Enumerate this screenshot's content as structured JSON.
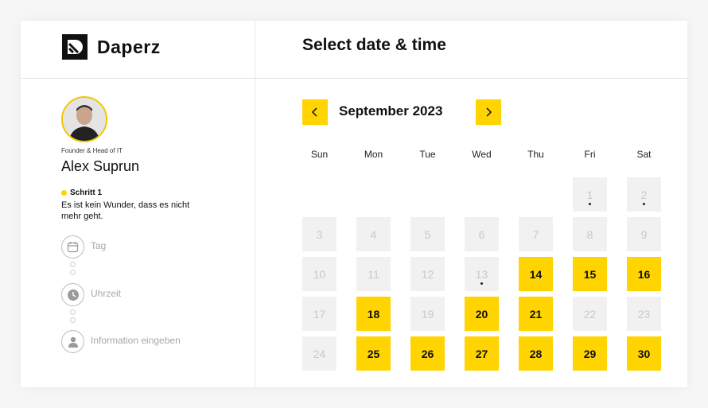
{
  "app": {
    "name": "Daperz"
  },
  "header": {
    "title": "Select date & time"
  },
  "profile": {
    "role": "Founder & Head of IT",
    "name": "Alex Suprun",
    "step_title": "Schritt 1",
    "step_description": "Es ist kein Wunder, dass es nicht mehr geht."
  },
  "steps": [
    {
      "label": "Tag",
      "icon": "calendar-icon"
    },
    {
      "label": "Uhrzeit",
      "icon": "clock-icon"
    },
    {
      "label": "Information eingeben",
      "icon": "user-icon"
    }
  ],
  "calendar": {
    "month_label": "September 2023",
    "weekdays": [
      "Sun",
      "Mon",
      "Tue",
      "Wed",
      "Thu",
      "Fri",
      "Sat"
    ],
    "days": [
      {
        "label": "1",
        "available": false,
        "marked": true
      },
      {
        "label": "2",
        "available": false,
        "marked": true
      },
      {
        "label": "3",
        "available": false,
        "marked": false
      },
      {
        "label": "4",
        "available": false,
        "marked": false
      },
      {
        "label": "5",
        "available": false,
        "marked": false
      },
      {
        "label": "6",
        "available": false,
        "marked": false
      },
      {
        "label": "7",
        "available": false,
        "marked": false
      },
      {
        "label": "8",
        "available": false,
        "marked": false
      },
      {
        "label": "9",
        "available": false,
        "marked": false
      },
      {
        "label": "10",
        "available": false,
        "marked": false
      },
      {
        "label": "11",
        "available": false,
        "marked": false
      },
      {
        "label": "12",
        "available": false,
        "marked": false
      },
      {
        "label": "13",
        "available": false,
        "marked": true
      },
      {
        "label": "14",
        "available": true,
        "marked": false
      },
      {
        "label": "15",
        "available": true,
        "marked": false
      },
      {
        "label": "16",
        "available": true,
        "marked": false
      },
      {
        "label": "17",
        "available": false,
        "marked": false
      },
      {
        "label": "18",
        "available": true,
        "marked": false
      },
      {
        "label": "19",
        "available": false,
        "marked": false
      },
      {
        "label": "20",
        "available": true,
        "marked": false
      },
      {
        "label": "21",
        "available": true,
        "marked": false
      },
      {
        "label": "22",
        "available": false,
        "marked": false
      },
      {
        "label": "23",
        "available": false,
        "marked": false
      },
      {
        "label": "24",
        "available": false,
        "marked": false
      },
      {
        "label": "25",
        "available": true,
        "marked": false
      },
      {
        "label": "26",
        "available": true,
        "marked": false
      },
      {
        "label": "27",
        "available": true,
        "marked": false
      },
      {
        "label": "28",
        "available": true,
        "marked": false
      },
      {
        "label": "29",
        "available": true,
        "marked": false
      },
      {
        "label": "30",
        "available": true,
        "marked": false
      }
    ]
  },
  "colors": {
    "accent": "#ffd400",
    "unavailable_bg": "#f1f1f1",
    "unavailable_text": "#c9c9c9"
  }
}
